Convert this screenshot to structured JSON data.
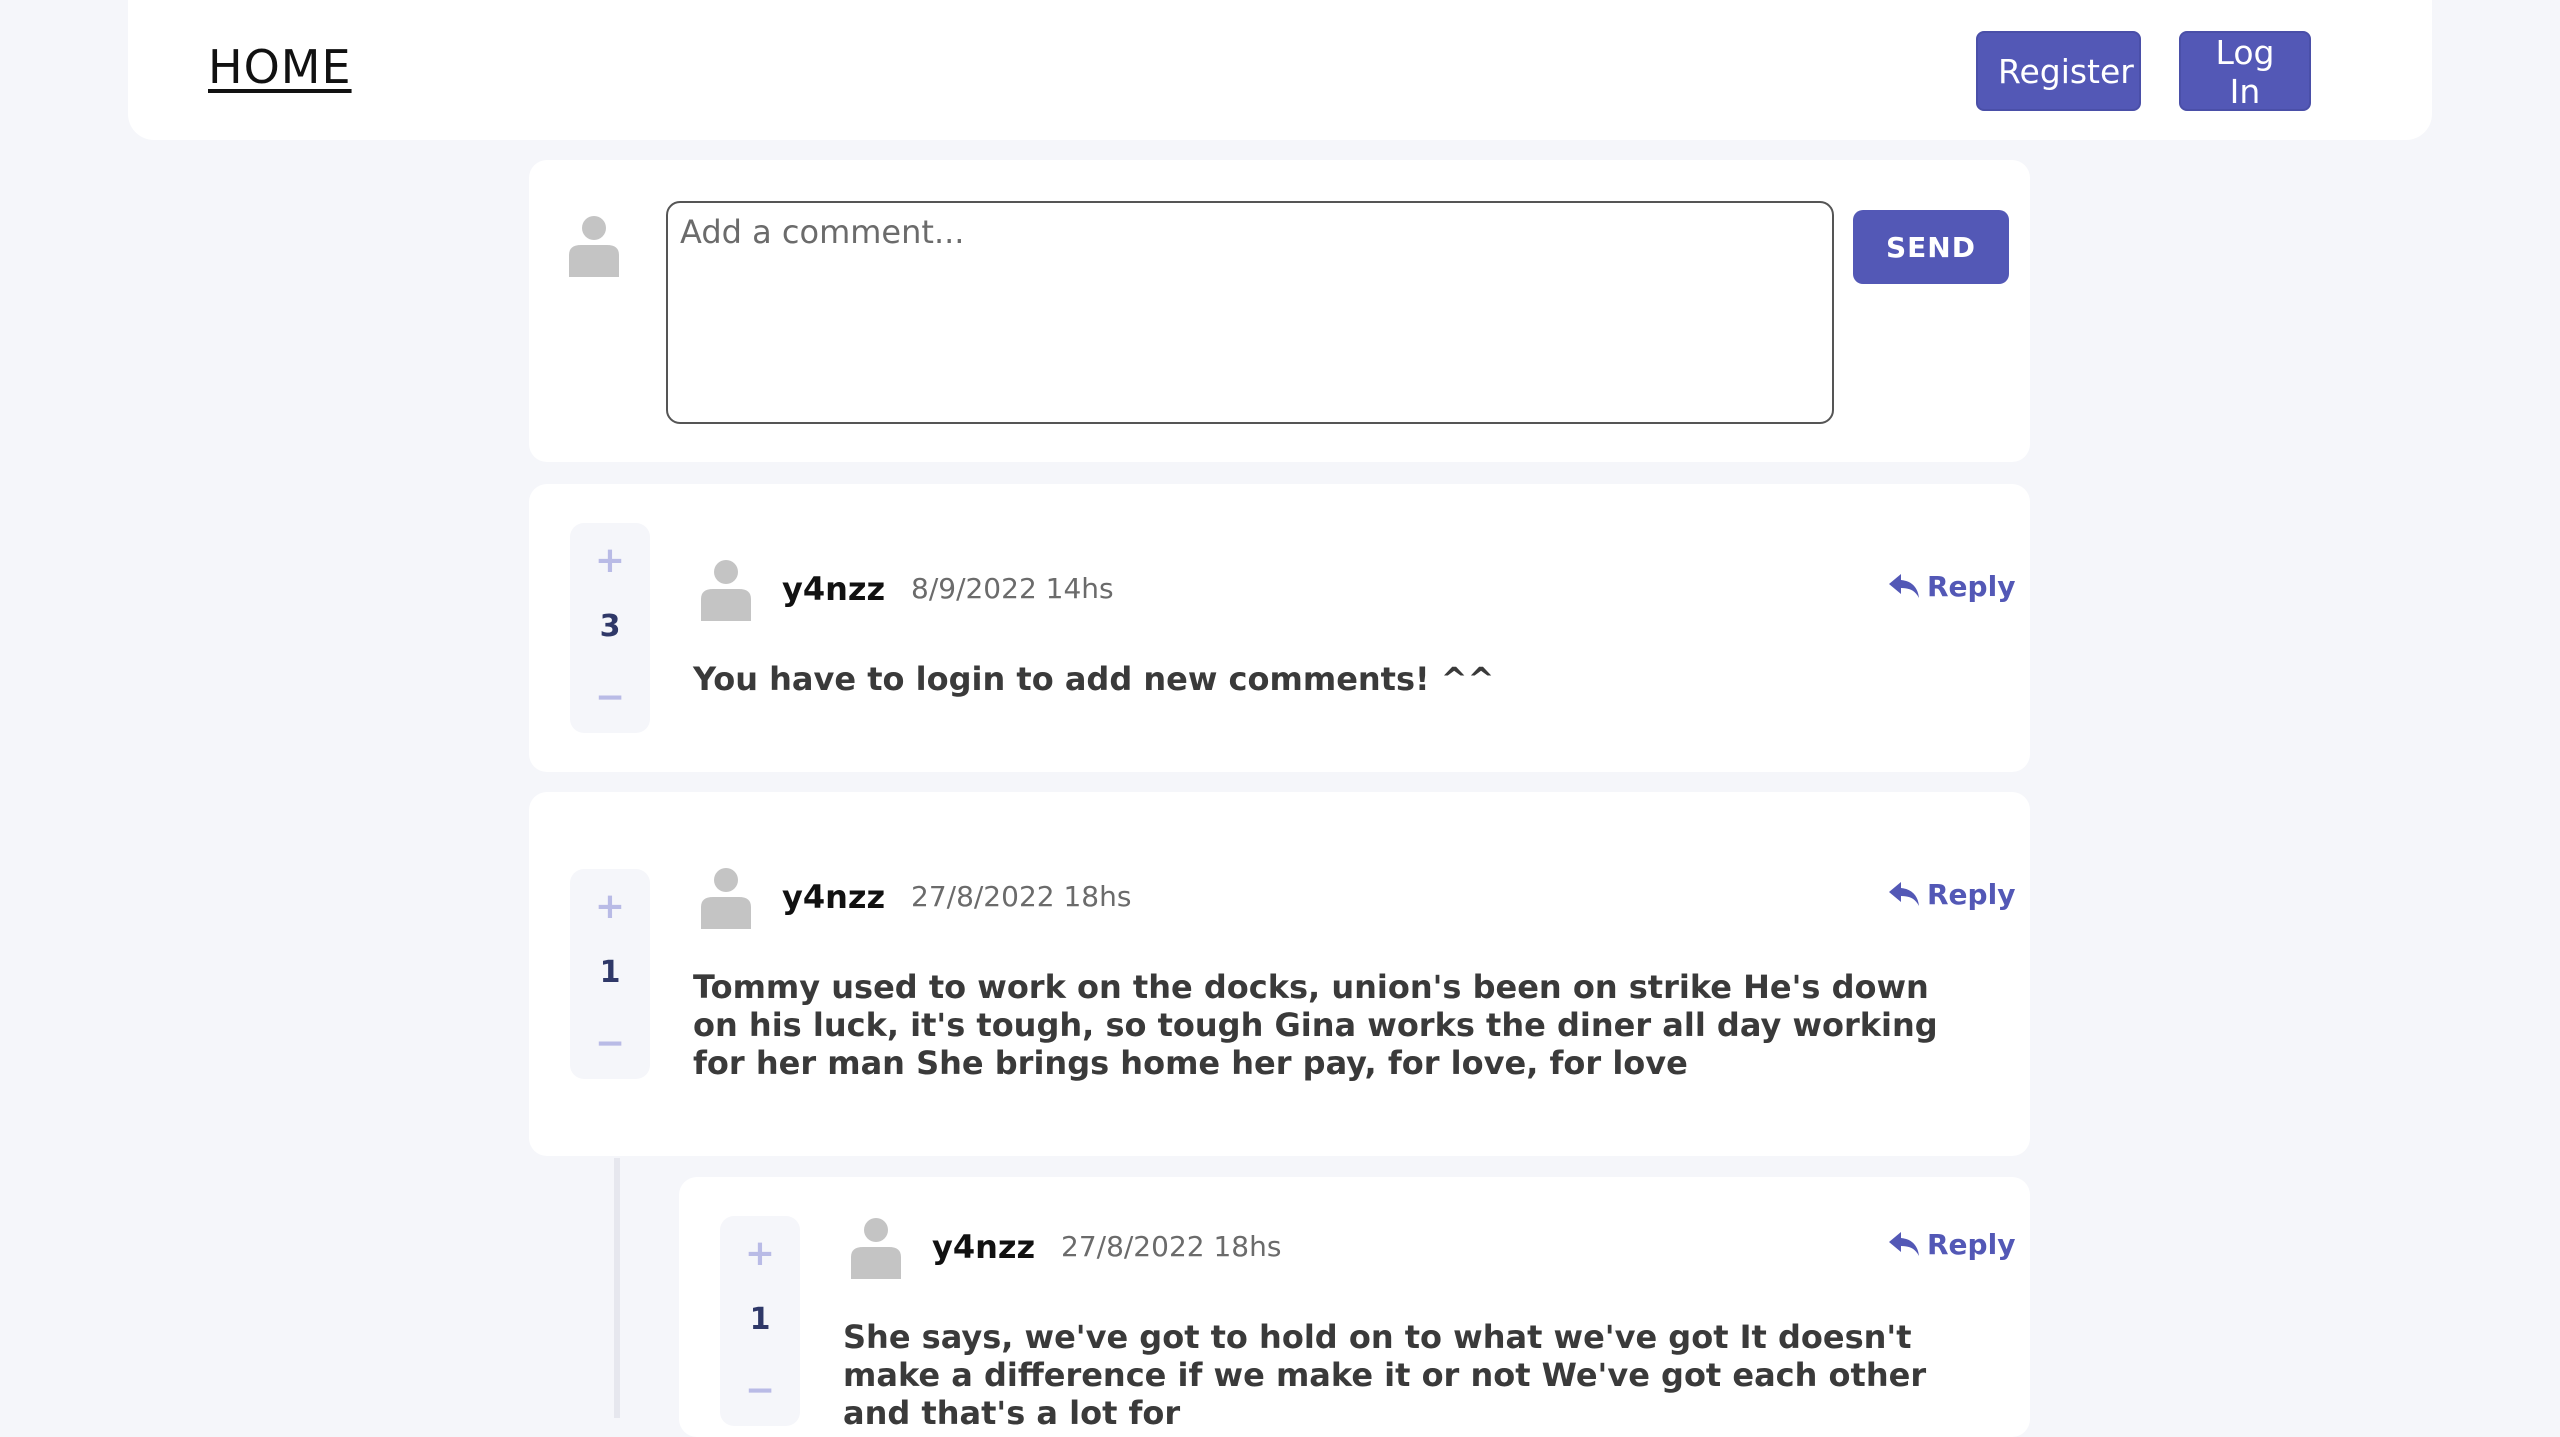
{
  "nav": {
    "home_label": "HOME",
    "register_label": "Register",
    "login_label": "Log In"
  },
  "composer": {
    "placeholder": "Add a comment...",
    "send_label": "SEND"
  },
  "colors": {
    "accent": "#5358b6",
    "vote_icon": "#b9bbe6",
    "background": "#f5f6fa"
  },
  "comments": [
    {
      "score": "3",
      "username": "y4nzz",
      "date": "8/9/2022 14hs",
      "reply_label": "Reply",
      "text": "You have to login to add new comments! ^^"
    },
    {
      "score": "1",
      "username": "y4nzz",
      "date": "27/8/2022 18hs",
      "reply_label": "Reply",
      "text": "Tommy used to work on the docks, union's been on strike He's down on his luck, it's tough, so tough Gina works the diner all day working for her man She brings home her pay, for love, for love"
    },
    {
      "score": "1",
      "username": "y4nzz",
      "date": "27/8/2022 18hs",
      "reply_label": "Reply",
      "text": "She says, we've got to hold on to what we've got It doesn't make a difference if we make it or not We've got each other and that's a lot for"
    }
  ],
  "vote_controls": {
    "plus": "+",
    "minus": "−"
  }
}
